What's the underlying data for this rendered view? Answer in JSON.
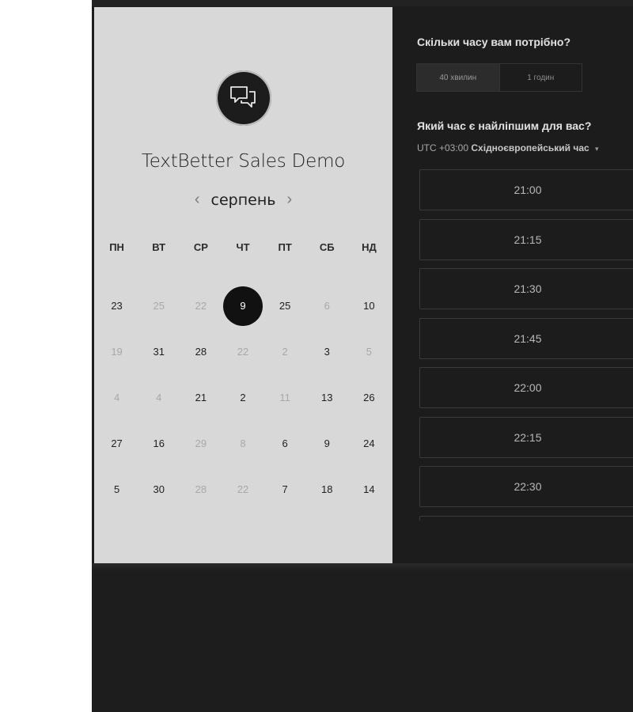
{
  "calendar": {
    "title": "TextBetter Sales Demo",
    "month": "серпень",
    "prev_arrow": "‹",
    "next_arrow": "›",
    "weekdays": [
      "ПН",
      "ВТ",
      "СР",
      "ЧТ",
      "ПТ",
      "СБ",
      "НД"
    ],
    "weeks": [
      [
        {
          "d": "23",
          "s": "on"
        },
        {
          "d": "25",
          "s": "off"
        },
        {
          "d": "22",
          "s": "off"
        },
        {
          "d": "9",
          "s": "sel"
        },
        {
          "d": "25",
          "s": "on"
        },
        {
          "d": "6",
          "s": "off"
        },
        {
          "d": "10",
          "s": "on"
        }
      ],
      [
        {
          "d": "19",
          "s": "off"
        },
        {
          "d": "31",
          "s": "on"
        },
        {
          "d": "28",
          "s": "on"
        },
        {
          "d": "22",
          "s": "off"
        },
        {
          "d": "2",
          "s": "off"
        },
        {
          "d": "3",
          "s": "on"
        },
        {
          "d": "5",
          "s": "off"
        }
      ],
      [
        {
          "d": "4",
          "s": "off"
        },
        {
          "d": "4",
          "s": "off"
        },
        {
          "d": "21",
          "s": "on"
        },
        {
          "d": "2",
          "s": "on"
        },
        {
          "d": "11",
          "s": "off"
        },
        {
          "d": "13",
          "s": "on"
        },
        {
          "d": "26",
          "s": "on"
        }
      ],
      [
        {
          "d": "27",
          "s": "on"
        },
        {
          "d": "16",
          "s": "on"
        },
        {
          "d": "29",
          "s": "off"
        },
        {
          "d": "8",
          "s": "off"
        },
        {
          "d": "6",
          "s": "on"
        },
        {
          "d": "9",
          "s": "on"
        },
        {
          "d": "24",
          "s": "on"
        }
      ],
      [
        {
          "d": "5",
          "s": "on"
        },
        {
          "d": "30",
          "s": "on"
        },
        {
          "d": "28",
          "s": "off"
        },
        {
          "d": "22",
          "s": "off"
        },
        {
          "d": "7",
          "s": "on"
        },
        {
          "d": "18",
          "s": "on"
        },
        {
          "d": "14",
          "s": "on"
        }
      ]
    ]
  },
  "booking": {
    "duration_question": "Скільки часу вам потрібно?",
    "durations": [
      "40 хвилин",
      "1 годин"
    ],
    "time_question": "Який час є найліпшим для вас?",
    "timezone_offset": "UTC +03:00",
    "timezone_name": "Східноєвропейський час",
    "caret": "▾",
    "slots": [
      "21:00",
      "21:15",
      "21:30",
      "21:45",
      "22:00",
      "22:15",
      "22:30",
      ""
    ]
  },
  "colors": {
    "left_bg": "#d8d8d8",
    "right_bg": "#1c1c1c",
    "selected_day": "#111111"
  }
}
